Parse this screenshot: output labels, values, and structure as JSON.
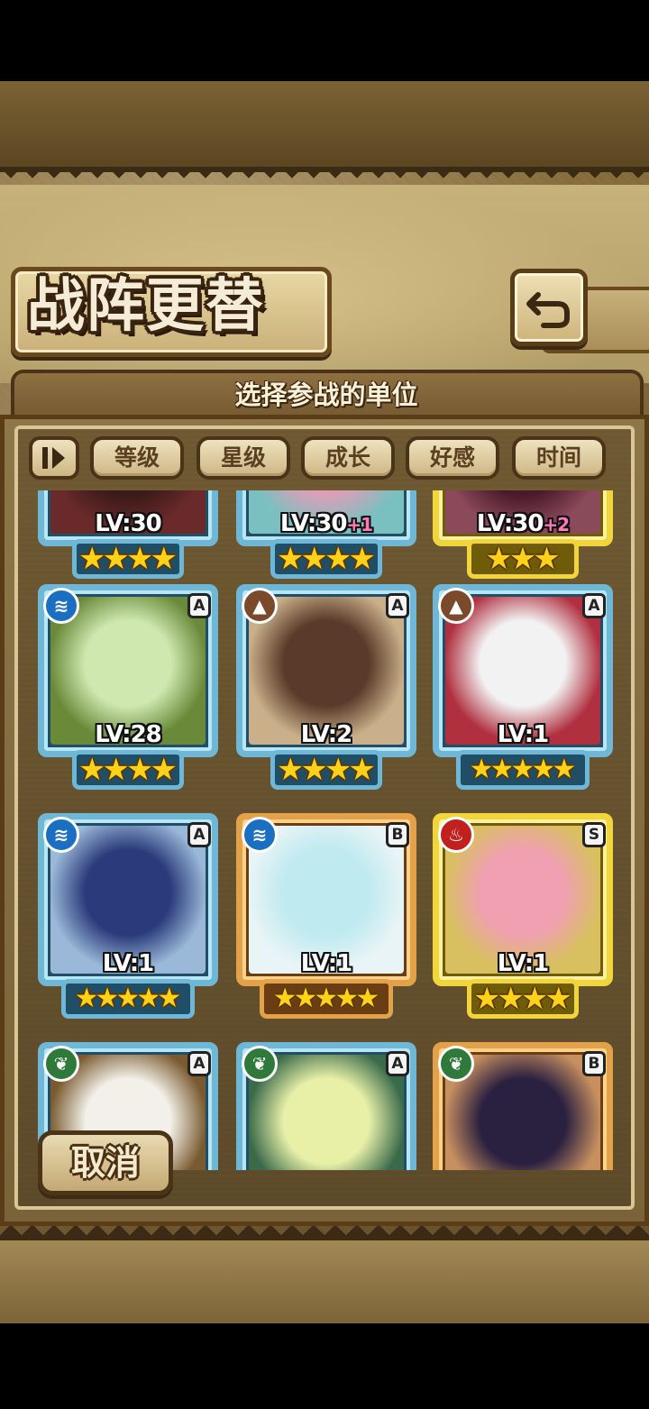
{
  "header": {
    "title": "战阵更替",
    "subtitle": "选择参战的单位"
  },
  "sort_buttons": [
    "等级",
    "星级",
    "成长",
    "好感",
    "时间"
  ],
  "units": [
    {
      "lv": "LV:30",
      "bonus": "",
      "stars": 4,
      "frame": "blue",
      "element": "",
      "rank": ""
    },
    {
      "lv": "LV:30",
      "bonus": "+1",
      "stars": 4,
      "frame": "blue",
      "element": "",
      "rank": ""
    },
    {
      "lv": "LV:30",
      "bonus": "+2",
      "stars": 3,
      "frame": "yellow",
      "element": "",
      "rank": ""
    },
    {
      "lv": "LV:28",
      "bonus": "",
      "stars": 4,
      "frame": "blue",
      "element": "water",
      "rank": "A"
    },
    {
      "lv": "LV:2",
      "bonus": "",
      "stars": 4,
      "frame": "blue",
      "element": "earth",
      "rank": "A"
    },
    {
      "lv": "LV:1",
      "bonus": "",
      "stars": 5,
      "frame": "blue",
      "element": "earth",
      "rank": "A"
    },
    {
      "lv": "LV:1",
      "bonus": "",
      "stars": 5,
      "frame": "blue",
      "element": "water",
      "rank": "A"
    },
    {
      "lv": "LV:1",
      "bonus": "",
      "stars": 5,
      "frame": "gold",
      "element": "water",
      "rank": "B"
    },
    {
      "lv": "LV:1",
      "bonus": "",
      "stars": 4,
      "frame": "yellow",
      "element": "fire",
      "rank": "S"
    },
    {
      "lv": "",
      "bonus": "",
      "stars": 0,
      "frame": "blue",
      "element": "wind",
      "rank": "A"
    },
    {
      "lv": "",
      "bonus": "",
      "stars": 0,
      "frame": "blue",
      "element": "wind",
      "rank": "A"
    },
    {
      "lv": "",
      "bonus": "",
      "stars": 0,
      "frame": "gold",
      "element": "wind",
      "rank": "B"
    }
  ],
  "cancel_label": "取消",
  "icons": {
    "back": "return-arrow-icon",
    "sort_toggle": "sort-order-icon",
    "elements": {
      "water": "water-wave-icon",
      "earth": "mountain-icon",
      "fire": "flame-icon",
      "wind": "leaf-icon"
    }
  },
  "colors": {
    "parchment": "#c8b27c",
    "panel": "#7a6338",
    "frame_blue": "#6fb7d6",
    "frame_gold": "#e3a24a",
    "frame_yellow": "#f1d53a",
    "star": "#ffd21a",
    "level_bonus": "#ff7ab6"
  }
}
